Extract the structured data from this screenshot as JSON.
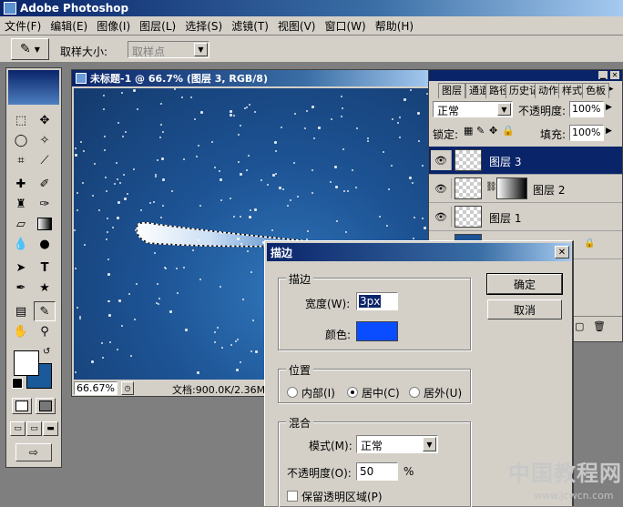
{
  "app": {
    "title": "Adobe Photoshop"
  },
  "menu": [
    "文件(F)",
    "编辑(E)",
    "图像(I)",
    "图层(L)",
    "选择(S)",
    "滤镜(T)",
    "视图(V)",
    "窗口(W)",
    "帮助(H)"
  ],
  "options_bar": {
    "sample_size_label": "取样大小:",
    "sample_size_value": "取样点"
  },
  "document": {
    "title": "未标题-1 @ 66.7% (图层 3, RGB/8)",
    "zoom": "66.67%",
    "doc_size": "文档:900.0K/2.36M"
  },
  "layers_panel": {
    "tabs": [
      "图层",
      "通道",
      "路径",
      "历史记录",
      "动作",
      "样式",
      "色板"
    ],
    "blend_mode": "正常",
    "opacity_label": "不透明度:",
    "opacity_value": "100%",
    "lock_label": "锁定:",
    "fill_label": "填充:",
    "fill_value": "100%",
    "layers": [
      {
        "name": "图层 3",
        "selected": true
      },
      {
        "name": "图层 2",
        "selected": false
      },
      {
        "name": "图层 1",
        "selected": false
      }
    ]
  },
  "dialog": {
    "title": "描边",
    "stroke_group": "描边",
    "width_label": "宽度(W):",
    "width_value": "3px",
    "color_label": "颜色:",
    "stroke_color": "#0a4cff",
    "location_group": "位置",
    "location_options": [
      "内部(I)",
      "居中(C)",
      "居外(U)"
    ],
    "location_selected": "居中(C)",
    "blend_group": "混合",
    "mode_label": "模式(M):",
    "mode_value": "正常",
    "opacity_label": "不透明度(O):",
    "opacity_value": "50",
    "opacity_unit": "%",
    "preserve_label": "保留透明区域(P)",
    "ok_label": "确定",
    "cancel_label": "取消"
  },
  "watermark": {
    "text": "中国教程网",
    "url": "www.jcwcn.com"
  },
  "colors": {
    "title_blue": "#0a246a",
    "canvas_blue": "#1d5394",
    "foreground": "#ffffff",
    "background": "#1a5a9a"
  }
}
